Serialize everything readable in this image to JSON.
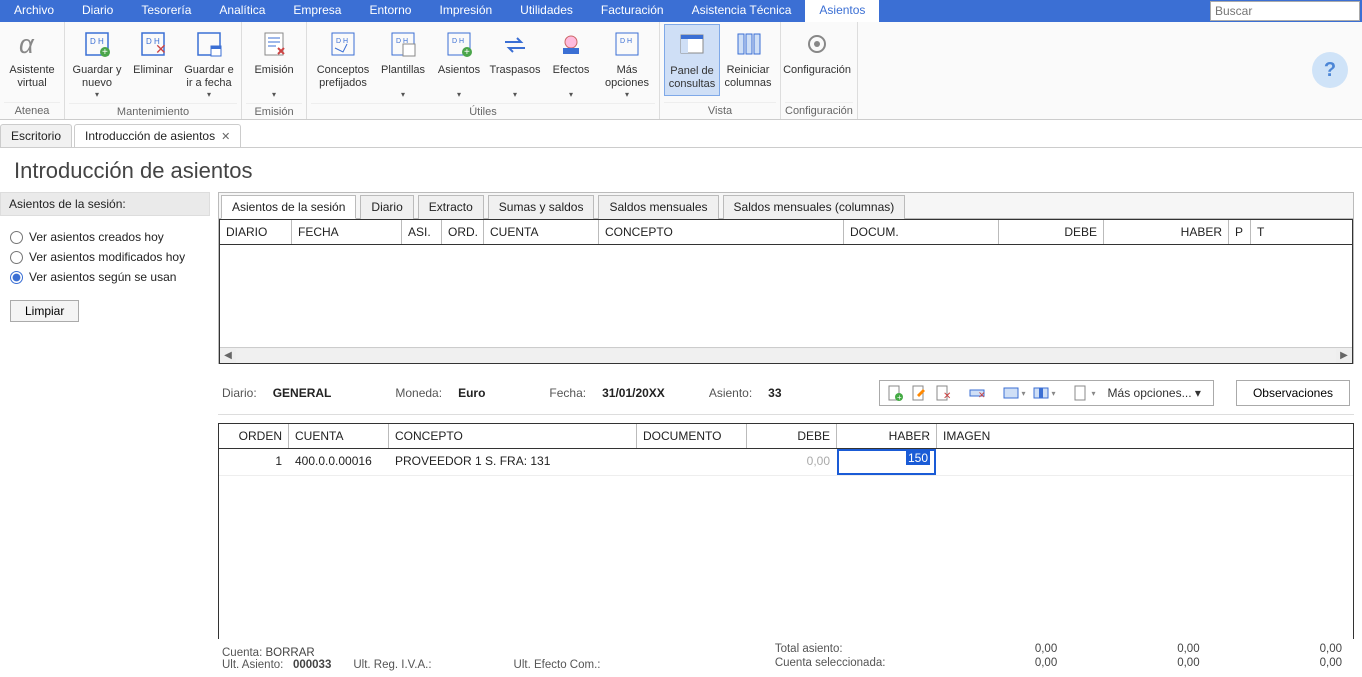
{
  "menubar": {
    "items": [
      "Archivo",
      "Diario",
      "Tesorería",
      "Analítica",
      "Empresa",
      "Entorno",
      "Impresión",
      "Utilidades",
      "Facturación",
      "Asistencia Técnica",
      "Asientos"
    ],
    "active_index": 10,
    "search_placeholder": "Buscar"
  },
  "ribbon": {
    "groups": [
      {
        "label": "Atenea",
        "buttons": [
          {
            "text": "Asistente virtual"
          }
        ]
      },
      {
        "label": "Mantenimiento",
        "buttons": [
          {
            "text": "Guardar y nuevo",
            "dropdown": true
          },
          {
            "text": "Eliminar"
          },
          {
            "text": "Guardar e ir a fecha",
            "dropdown": true
          }
        ]
      },
      {
        "label": "Emisión",
        "buttons": [
          {
            "text": "Emisión",
            "dropdown": true
          }
        ]
      },
      {
        "label": "Útiles",
        "buttons": [
          {
            "text": "Conceptos prefijados"
          },
          {
            "text": "Plantillas",
            "dropdown": true
          },
          {
            "text": "Asientos",
            "dropdown": true
          },
          {
            "text": "Traspasos",
            "dropdown": true
          },
          {
            "text": "Efectos",
            "dropdown": true
          },
          {
            "text": "Más opciones",
            "dropdown": true
          }
        ]
      },
      {
        "label": "Vista",
        "buttons": [
          {
            "text": "Panel de consultas",
            "selected": true
          },
          {
            "text": "Reiniciar columnas"
          }
        ]
      },
      {
        "label": "Configuración",
        "buttons": [
          {
            "text": "Configuración"
          }
        ]
      }
    ]
  },
  "workspace_tabs": {
    "items": [
      {
        "label": "Escritorio",
        "closable": false
      },
      {
        "label": "Introducción de asientos",
        "closable": true,
        "active": true
      }
    ]
  },
  "page_title": "Introducción de asientos",
  "sidebar": {
    "header": "Asientos de la sesión:",
    "radios": [
      {
        "label": "Ver asientos creados hoy",
        "checked": false
      },
      {
        "label": "Ver asientos modificados hoy",
        "checked": false
      },
      {
        "label": "Ver asientos según se usan",
        "checked": true
      }
    ],
    "clear_btn": "Limpiar"
  },
  "inner_tabs": {
    "items": [
      "Asientos de la sesión",
      "Diario",
      "Extracto",
      "Sumas y saldos",
      "Saldos mensuales",
      "Saldos mensuales (columnas)"
    ],
    "active_index": 0
  },
  "top_grid_headers": [
    "DIARIO",
    "FECHA",
    "ASI.",
    "ORD.",
    "CUENTA",
    "CONCEPTO",
    "DOCUM.",
    "DEBE",
    "HABER",
    "P",
    "T"
  ],
  "entry_header": {
    "diario_label": "Diario:",
    "diario": "GENERAL",
    "moneda_label": "Moneda:",
    "moneda": "Euro",
    "fecha_label": "Fecha:",
    "fecha": "31/01/20XX",
    "asiento_label": "Asiento:",
    "asiento": "33",
    "more_options": "Más opciones...",
    "observaciones": "Observaciones"
  },
  "low_grid": {
    "headers": [
      "ORDEN",
      "CUENTA",
      "CONCEPTO",
      "DOCUMENTO",
      "DEBE",
      "HABER",
      "IMAGEN"
    ],
    "rows": [
      {
        "orden": "1",
        "cuenta": "400.0.0.00016",
        "concepto": "PROVEEDOR 1 S. FRA:  131",
        "documento": "",
        "debe": "0,00",
        "haber": "150",
        "imagen": ""
      }
    ]
  },
  "status": {
    "cuenta_label": "Cuenta:",
    "cuenta": "BORRAR",
    "ult_asiento_label": "Ult. Asiento:",
    "ult_asiento": "000033",
    "ult_reg_iva_label": "Ult. Reg. I.V.A.:",
    "ult_reg_iva": "",
    "ult_efecto_label": "Ult. Efecto Com.:",
    "ult_efecto": "",
    "total_asiento_label": "Total asiento:",
    "cuenta_sel_label": "Cuenta seleccionada:",
    "totals": {
      "r1": [
        "0,00",
        "0,00",
        "0,00"
      ],
      "r2": [
        "0,00",
        "0,00",
        "0,00"
      ]
    }
  }
}
